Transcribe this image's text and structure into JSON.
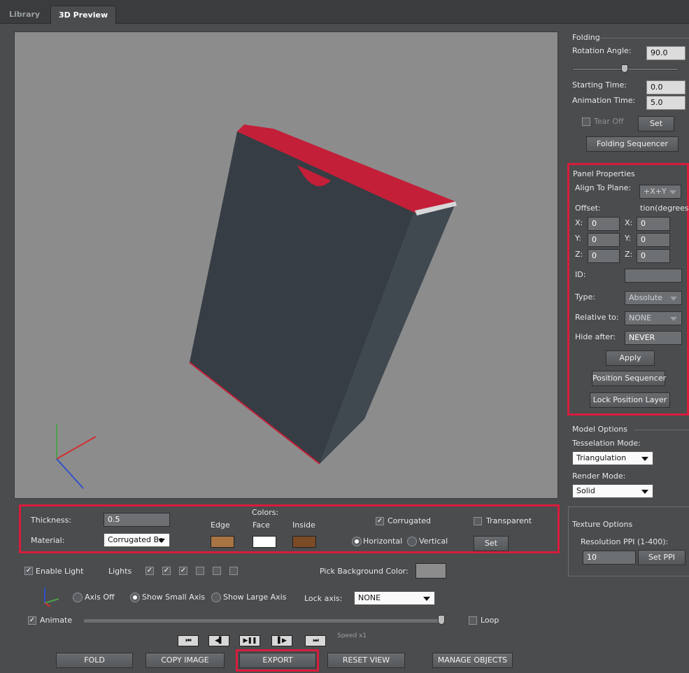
{
  "tabs": [
    {
      "label": "Library"
    },
    {
      "label": "3D Preview"
    }
  ],
  "folding": {
    "title": "Folding",
    "rotation_label": "Rotation Angle:",
    "rotation_value": "90.0",
    "start_label": "Starting Time:",
    "start_value": "0.0",
    "anim_label": "Animation Time:",
    "anim_value": "5.0",
    "tearoff_label": "Tear Off",
    "set_label": "Set",
    "sequencer_label": "Folding Sequencer"
  },
  "panel": {
    "title": "Panel Properties",
    "align_label": "Align To Plane:",
    "align_value": "+X+Y",
    "offset_label": "Offset:",
    "rotation_label": "tion(degrees):",
    "x_label": "X:",
    "y_label": "Y:",
    "z_label": "Z:",
    "offset_x": "0",
    "offset_y": "0",
    "offset_z": "0",
    "rot_x": "0",
    "rot_y": "0",
    "rot_z": "0",
    "id_label": "ID:",
    "id_value": "",
    "type_label": "Type:",
    "type_value": "Absolute",
    "relative_label": "Relative to:",
    "relative_value": "NONE",
    "hide_label": "Hide after:",
    "hide_value": "NEVER",
    "apply_label": "Apply",
    "pos_seq_label": "Position Sequencer",
    "lock_label": "Lock Position Layer"
  },
  "model": {
    "title": "Model Options",
    "tess_label": "Tesselation Mode:",
    "tess_value": "Triangulation",
    "render_label": "Render Mode:",
    "render_value": "Solid"
  },
  "texture": {
    "title": "Texture Options",
    "res_label": "Resolution PPI (1-400):",
    "res_value": "10",
    "set_label": "Set PPI"
  },
  "material": {
    "thickness_label": "Thickness:",
    "thickness_value": "0.5",
    "material_label": "Material:",
    "material_value": "Corrugated Bo",
    "colors_label": "Colors:",
    "edge_label": "Edge",
    "face_label": "Face",
    "inside_label": "Inside",
    "edge_color": "#a87444",
    "face_color": "#ffffff",
    "inside_color": "#7b4a26",
    "corrugated_label": "Corrugated",
    "corrugated_checked": true,
    "transparent_label": "Transparent",
    "transparent_checked": false,
    "horizontal_label": "Horizontal",
    "vertical_label": "Vertical",
    "set_label": "Set"
  },
  "lights": {
    "enable_label": "Enable Light",
    "lights_label": "Lights",
    "light_states": [
      true,
      true,
      true,
      false,
      false,
      false
    ],
    "pick_bg_label": "Pick Background Color:",
    "bg_color": "#8c8c8c"
  },
  "axis": {
    "off_label": "Axis Off",
    "small_label": "Show Small Axis",
    "large_label": "Show Large Axis",
    "lock_label": "Lock axis:",
    "lock_value": "NONE"
  },
  "animate": {
    "label": "Animate",
    "progress": 1.0,
    "loop_label": "Loop",
    "speed_label": "Speed x1"
  },
  "bottom_buttons": {
    "fold": "FOLD",
    "copy": "COPY IMAGE",
    "export": "EXPORT",
    "reset": "RESET VIEW",
    "manage": "MANAGE OBJECTS"
  },
  "colors": {
    "highlight": "#d91c3c",
    "box_lid": "#c8203a",
    "box_body": "#3a4148"
  }
}
